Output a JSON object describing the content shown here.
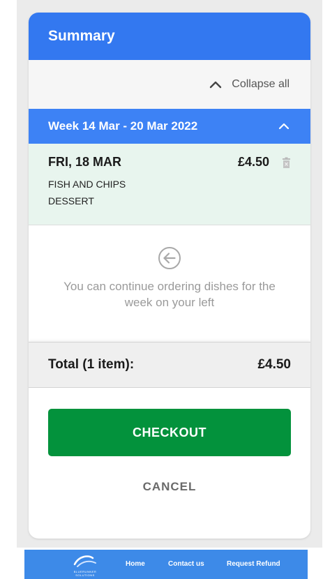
{
  "summary": {
    "title": "Summary",
    "collapse_label": "Collapse all",
    "week_label": "Week 14 Mar - 20 Mar 2022",
    "order": {
      "day": "FRI, 18 MAR",
      "price": "£4.50",
      "items": [
        "FISH AND CHIPS",
        "DESSERT"
      ]
    },
    "hint_text": "You can continue ordering dishes for the week on your left",
    "total_label": "Total (1 item):",
    "total_value": "£4.50",
    "checkout_label": "CHECKOUT",
    "cancel_label": "CANCEL"
  },
  "footer": {
    "logo_text": "BLUERUNNER SOLUTIONS",
    "links": [
      "Home",
      "Contact us",
      "Request Refund"
    ]
  },
  "colors": {
    "header_blue": "#3378f0",
    "week_blue": "#3d82f5",
    "order_bg": "#e8f5ee",
    "checkout_green": "#03923c",
    "footer_blue": "#3d8ae8"
  }
}
